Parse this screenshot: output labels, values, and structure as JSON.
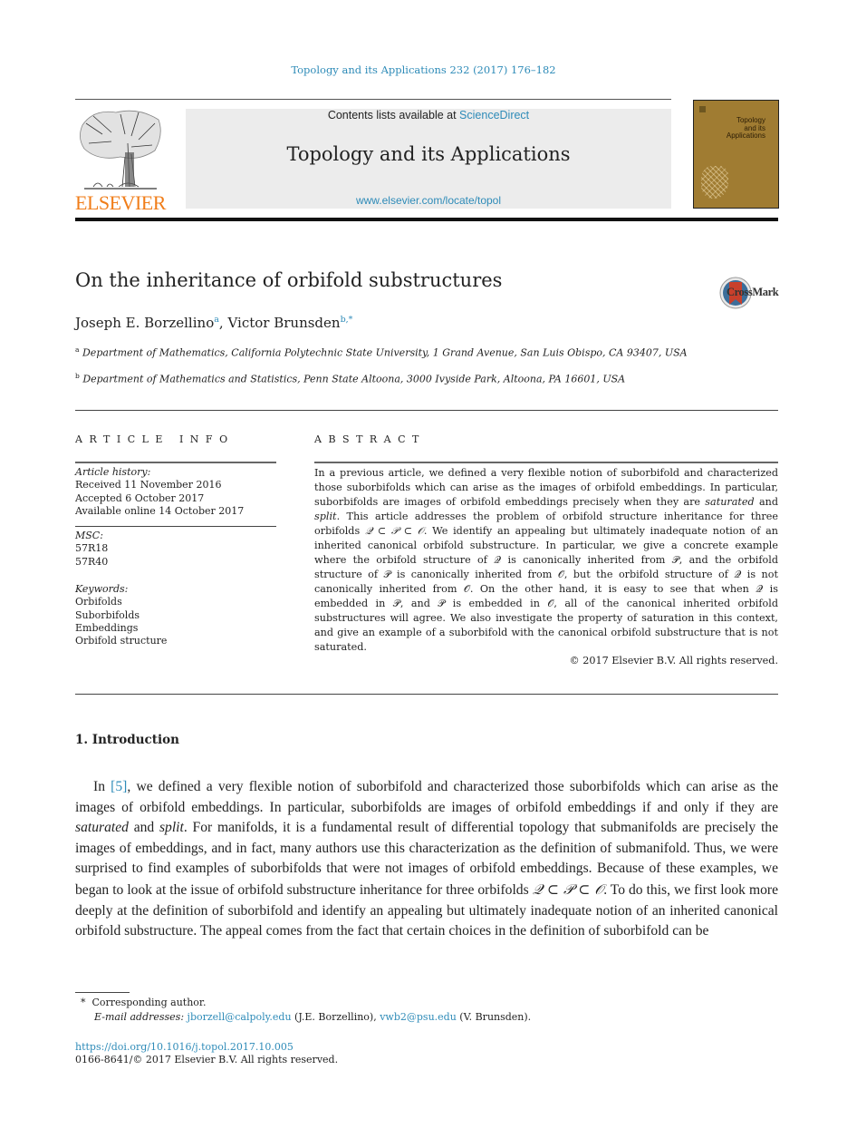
{
  "header": {
    "journal_reference": "Topology and its Applications 232 (2017) 176–182",
    "contents_prefix": "Contents lists available at ",
    "contents_link": "ScienceDirect",
    "journal_title": "Topology and its Applications",
    "journal_url": "www.elsevier.com/locate/topol",
    "publisher_logo_text": "ELSEVIER",
    "cover_title_lines": [
      "Topology",
      "and its",
      "Applications"
    ],
    "colors": {
      "link": "#2e8bb8",
      "elsevier_orange": "#f07d19",
      "cover_bg": "#a07c32"
    }
  },
  "article": {
    "title": "On the inheritance of orbifold substructures",
    "crossmark_label": "CrossMark",
    "authors": [
      {
        "name": "Joseph E. Borzellino",
        "marks": "a"
      },
      {
        "name": "Victor Brunsden",
        "marks": "b,*"
      }
    ],
    "author_separator": ", ",
    "affiliations": [
      {
        "mark": "a",
        "text": "Department of Mathematics, California Polytechnic State University, 1 Grand Avenue, San Luis Obispo, CA 93407, USA"
      },
      {
        "mark": "b",
        "text": "Department of Mathematics and Statistics, Penn State Altoona, 3000 Ivyside Park, Altoona, PA 16601, USA"
      }
    ]
  },
  "article_info": {
    "heading": "ARTICLE INFO",
    "history_label": "Article history:",
    "history": [
      "Received 11 November 2016",
      "Accepted 6 October 2017",
      "Available online 14 October 2017"
    ],
    "msc_label": "MSC:",
    "msc": [
      "57R18",
      "57R40"
    ],
    "keywords_label": "Keywords:",
    "keywords": [
      "Orbifolds",
      "Suborbifolds",
      "Embeddings",
      "Orbifold structure"
    ]
  },
  "abstract": {
    "heading": "ABSTRACT",
    "p1": "In a previous article, we defined a very flexible notion of suborbifold and characterized those suborbifolds which can arise as the images of orbifold embeddings. In particular, suborbifolds are images of orbifold embeddings precisely when they are ",
    "em1": "saturated",
    "and": " and ",
    "em2": "split",
    "p2": ". This article addresses the problem of orbifold structure inheritance for three orbifolds ",
    "math_chain": "𝒬 ⊂ 𝒫 ⊂ 𝒪",
    "p3": ". We identify an appealing but ultimately inadequate notion of an inherited canonical orbifold substructure. In particular, we give a concrete example where the orbifold structure of 𝒬 is canonically inherited from 𝒫, and the orbifold structure of 𝒫 is canonically inherited from 𝒪, but the orbifold structure of 𝒬 is not canonically inherited from 𝒪. On the other hand, it is easy to see that when 𝒬 is embedded in 𝒫, and 𝒫 is embedded in 𝒪, all of the canonical inherited orbifold substructures will agree. We also investigate the property of saturation in this context, and give an example of a suborbifold with the canonical orbifold substructure that is not saturated.",
    "copyright": "© 2017 Elsevier B.V. All rights reserved."
  },
  "body": {
    "section_heading": "1.  Introduction",
    "intro_1": "In ",
    "citation": "[5]",
    "intro_2": ", we defined a very flexible notion of suborbifold and characterized those suborbifolds which can arise as the images of orbifold embeddings. In particular, suborbifolds are images of orbifold embeddings if and only if they are ",
    "em1": "saturated",
    "and": " and ",
    "em2": "split",
    "intro_3": ". For manifolds, it is a fundamental result of differential topology that submanifolds are precisely the images of embeddings, and in fact, many authors use this characterization as the definition of submanifold. Thus, we were surprised to find examples of suborbifolds that were not images of orbifold embeddings. Because of these examples, we began to look at the issue of orbifold substructure inheritance for three orbifolds ",
    "math_chain": "𝒬 ⊂ 𝒫 ⊂ 𝒪",
    "intro_4": ". To do this, we first look more deeply at the definition of suborbifold and identify an appealing but ultimately inadequate notion of an inherited canonical orbifold substructure. The appeal comes from the fact that certain choices in the definition of suborbifold can be"
  },
  "footnotes": {
    "star": "*",
    "corresponding": "Corresponding author.",
    "email_label": "E-mail addresses:",
    "email_1": "jborzell@calpoly.edu",
    "email_1_owner": " (J.E. Borzellino), ",
    "email_2": "vwb2@psu.edu",
    "email_2_owner": " (V. Brunsden).",
    "doi": "https://doi.org/10.1016/j.topol.2017.10.005",
    "issn": "0166-8641/© 2017 Elsevier B.V. All rights reserved."
  }
}
